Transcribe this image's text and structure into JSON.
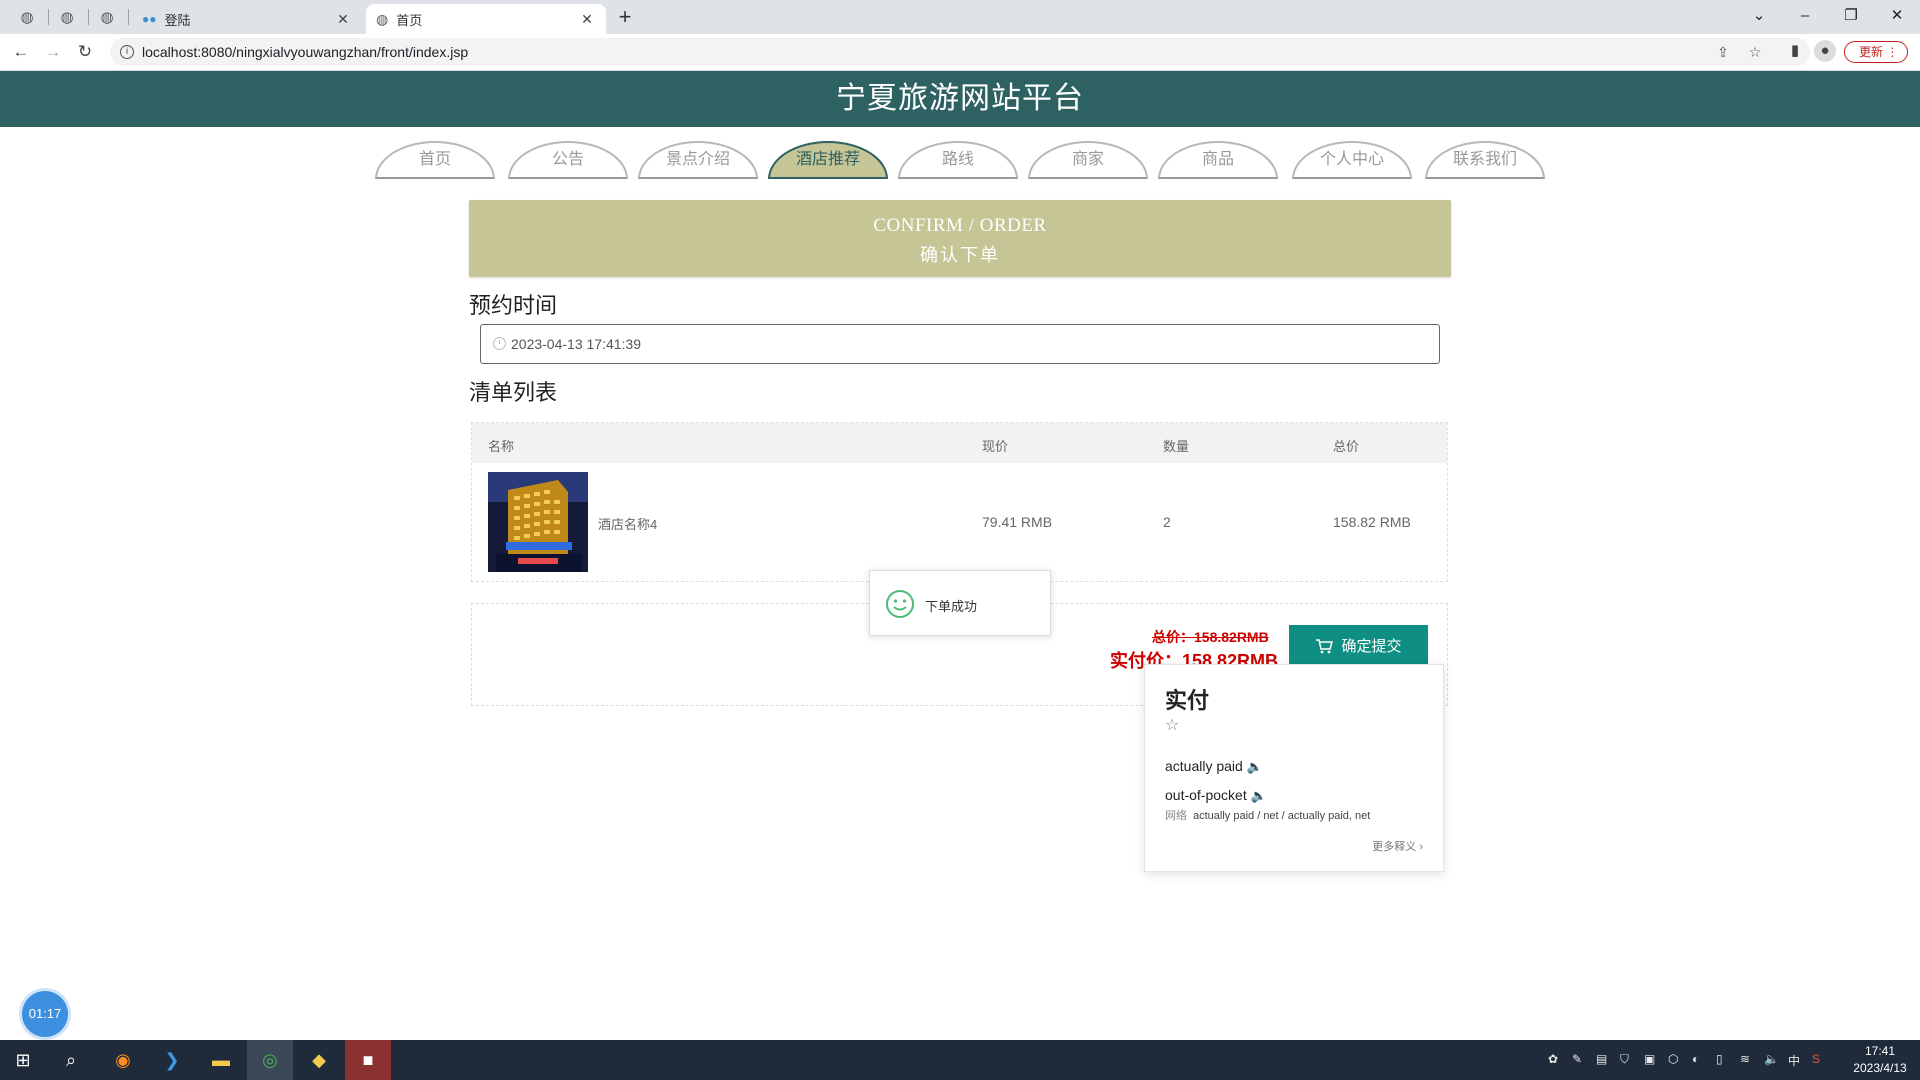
{
  "browser": {
    "tabs": [
      {
        "title": "登陆",
        "active": false
      },
      {
        "title": "首页",
        "active": true
      }
    ],
    "url": "localhost:8080/ningxialvyouwangzhan/front/index.jsp",
    "update_label": "更新"
  },
  "site": {
    "title": "宁夏旅游网站平台",
    "nav": [
      {
        "label": "首页",
        "active": false
      },
      {
        "label": "公告",
        "active": false
      },
      {
        "label": "景点介绍",
        "active": false
      },
      {
        "label": "酒店推荐",
        "active": true
      },
      {
        "label": "路线",
        "active": false
      },
      {
        "label": "商家",
        "active": false
      },
      {
        "label": "商品",
        "active": false
      },
      {
        "label": "个人中心",
        "active": false
      },
      {
        "label": "联系我们",
        "active": false
      }
    ]
  },
  "banner": {
    "en": "CONFIRM / ORDER",
    "cn": "确认下单"
  },
  "booking": {
    "label": "预约时间",
    "datetime": "2023-04-13 17:41:39"
  },
  "list": {
    "label": "清单列表",
    "columns": [
      "名称",
      "现价",
      "数量",
      "总价"
    ],
    "rows": [
      {
        "name": "酒店名称4",
        "price": "79.41 RMB",
        "qty": "2",
        "total": "158.82 RMB"
      }
    ]
  },
  "summary": {
    "total": "总价：158.82RMB",
    "actual": "实付价：158.82RMB",
    "submit_label": "确定提交"
  },
  "toast": {
    "message": "下单成功"
  },
  "dict_popup": {
    "word": "实付",
    "defs": [
      "actually paid",
      "out-of-pocket"
    ],
    "web_label": "网络",
    "web_text": "actually paid / net / actually paid, net",
    "more": "更多释义"
  },
  "timer": "01:17",
  "taskbar": {
    "time": "17:41",
    "date": "2023/4/13",
    "ime": "中"
  },
  "colors": {
    "header_bg": "#2e6162",
    "accent_olive": "#c5c596",
    "submit_bg": "#0f8f83",
    "price_red": "#cc0000"
  }
}
